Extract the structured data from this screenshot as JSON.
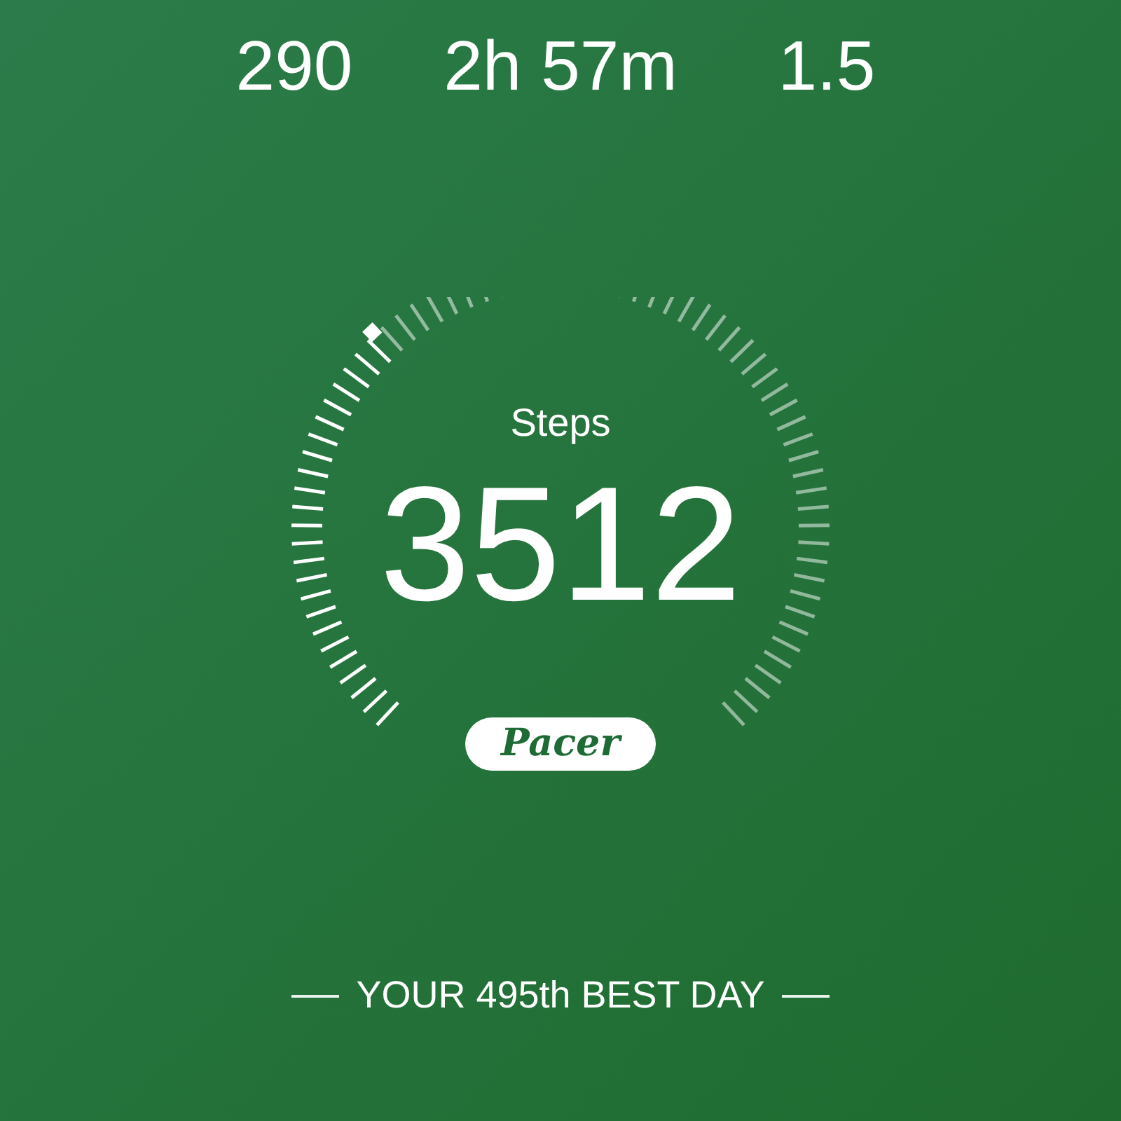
{
  "stats": [
    {
      "value": "290"
    },
    {
      "value": "2h 57m"
    },
    {
      "value": "1.5"
    }
  ],
  "dial": {
    "label": "Steps",
    "value": "3512"
  },
  "logo": "Pacer",
  "ranking": "YOUR 495th BEST DAY"
}
